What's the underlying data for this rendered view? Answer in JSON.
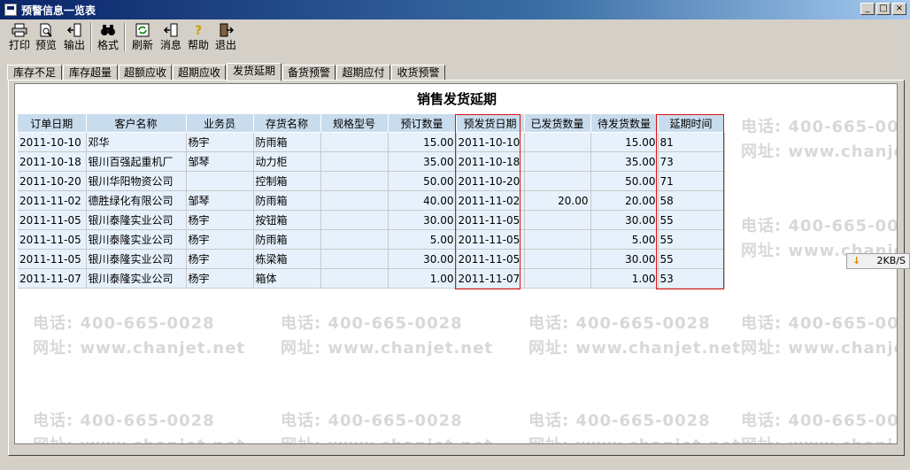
{
  "window": {
    "title": "预警信息一览表",
    "minimize": "_",
    "maximize": "□",
    "close": "×"
  },
  "toolbar": {
    "buttons": [
      {
        "label": "打印",
        "icon": "printer-icon"
      },
      {
        "label": "预览",
        "icon": "preview-icon"
      },
      {
        "label": "输出",
        "icon": "export-icon"
      },
      {
        "label": "格式",
        "icon": "binoculars-icon"
      },
      {
        "label": "刷新",
        "icon": "refresh-icon"
      },
      {
        "label": "消息",
        "icon": "message-icon"
      },
      {
        "label": "帮助",
        "icon": "help-icon"
      },
      {
        "label": "退出",
        "icon": "exit-icon"
      }
    ]
  },
  "tabs": [
    {
      "label": "库存不足"
    },
    {
      "label": "库存超量"
    },
    {
      "label": "超额应收"
    },
    {
      "label": "超期应收"
    },
    {
      "label": "发货延期",
      "active": true
    },
    {
      "label": "备货预警"
    },
    {
      "label": "超期应付"
    },
    {
      "label": "收货预警"
    }
  ],
  "report": {
    "title": "销售发货延期",
    "columns": [
      "订单日期",
      "客户名称",
      "业务员",
      "存货名称",
      "规格型号",
      "预订数量",
      "预发货日期",
      "已发货数量",
      "待发货数量",
      "延期时间"
    ],
    "rows": [
      [
        "2011-10-10",
        "邓华",
        "杨宇",
        "防雨箱",
        "",
        "15.00",
        "2011-10-10",
        "",
        "15.00",
        "81"
      ],
      [
        "2011-10-18",
        "银川百强起重机厂",
        "邹琴",
        "动力柜",
        "",
        "35.00",
        "2011-10-18",
        "",
        "35.00",
        "73"
      ],
      [
        "2011-10-20",
        "银川华阳物资公司",
        "",
        "控制箱",
        "",
        "50.00",
        "2011-10-20",
        "",
        "50.00",
        "71"
      ],
      [
        "2011-11-02",
        "德胜绿化有限公司",
        "邹琴",
        "防雨箱",
        "",
        "40.00",
        "2011-11-02",
        "20.00",
        "20.00",
        "58"
      ],
      [
        "2011-11-05",
        "银川泰隆实业公司",
        "杨宇",
        "按钮箱",
        "",
        "30.00",
        "2011-11-05",
        "",
        "30.00",
        "55"
      ],
      [
        "2011-11-05",
        "银川泰隆实业公司",
        "杨宇",
        "防雨箱",
        "",
        "5.00",
        "2011-11-05",
        "",
        "5.00",
        "55"
      ],
      [
        "2011-11-05",
        "银川泰隆实业公司",
        "杨宇",
        "栋梁箱",
        "",
        "30.00",
        "2011-11-05",
        "",
        "30.00",
        "55"
      ],
      [
        "2011-11-07",
        "银川泰隆实业公司",
        "杨宇",
        "箱体",
        "",
        "1.00",
        "2011-11-07",
        "",
        "1.00",
        "53"
      ]
    ]
  },
  "watermark": {
    "phone": "电话: 400-665-0028",
    "site": "网址: www.chanjet.net"
  },
  "speed_widget": {
    "text": "2KB/S"
  },
  "colors": {
    "title_bar": "#0a246a",
    "grid_header": "#c9dcee",
    "grid_cell": "#e6f1fb",
    "highlight": "#e01010"
  }
}
